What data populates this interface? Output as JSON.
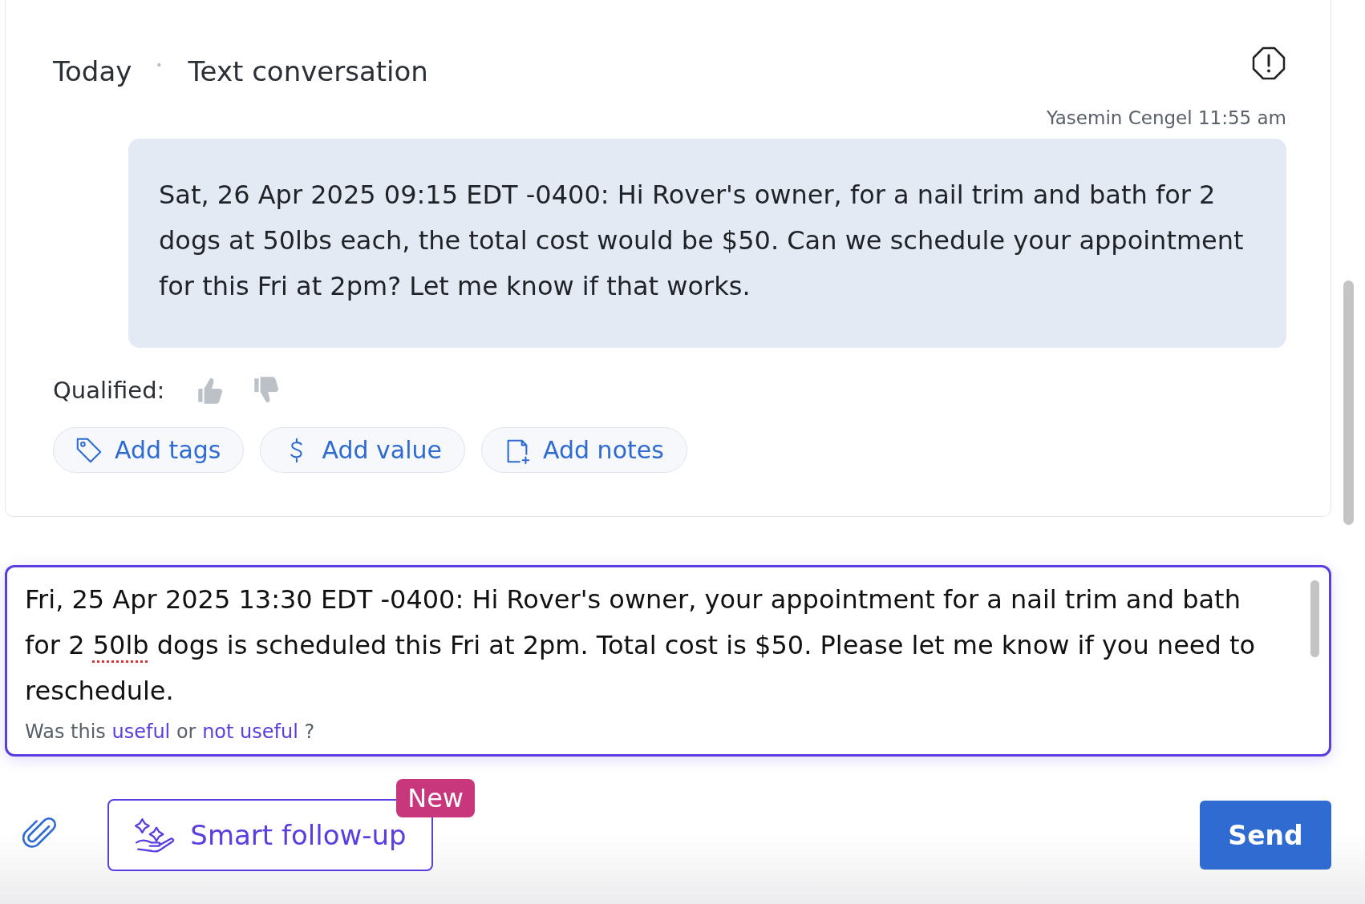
{
  "header": {
    "date": "Today",
    "separator": "•",
    "channel": "Text conversation"
  },
  "message": {
    "sender": "Yasemin Cengel 11:55 am",
    "text": "Sat, 26 Apr 2025 09:15 EDT -0400: Hi Rover's owner, for a nail trim and bath for 2 dogs at 50lbs each, the total cost would be $50. Can we schedule your appointment for this Fri at 2pm? Let me know if that works."
  },
  "qualified": {
    "label": "Qualified:",
    "options": [
      {
        "kind": "up",
        "selected": false
      },
      {
        "kind": "down",
        "selected": false
      }
    ]
  },
  "actions": [
    {
      "kind": "tag",
      "label": "Add tags"
    },
    {
      "kind": "value",
      "label": "Add value"
    },
    {
      "kind": "notes",
      "label": "Add notes"
    }
  ],
  "composer": {
    "value_parts": [
      "Fri, 25 Apr 2025 13:30 EDT -0400: Hi Rover's owner, your appointment for a nail trim and bath for 2 ",
      "50lb",
      " dogs is scheduled this Fri at 2pm. Total cost is $50. Please let me know if you need to reschedule."
    ],
    "feedback": {
      "prefix": "Was this",
      "useful": "useful",
      "middle": "or",
      "not_useful": "not useful",
      "suffix": "?"
    }
  },
  "smart_follow_up": {
    "label": "Smart follow-up",
    "badge": "New"
  },
  "send": {
    "label": "Send"
  }
}
